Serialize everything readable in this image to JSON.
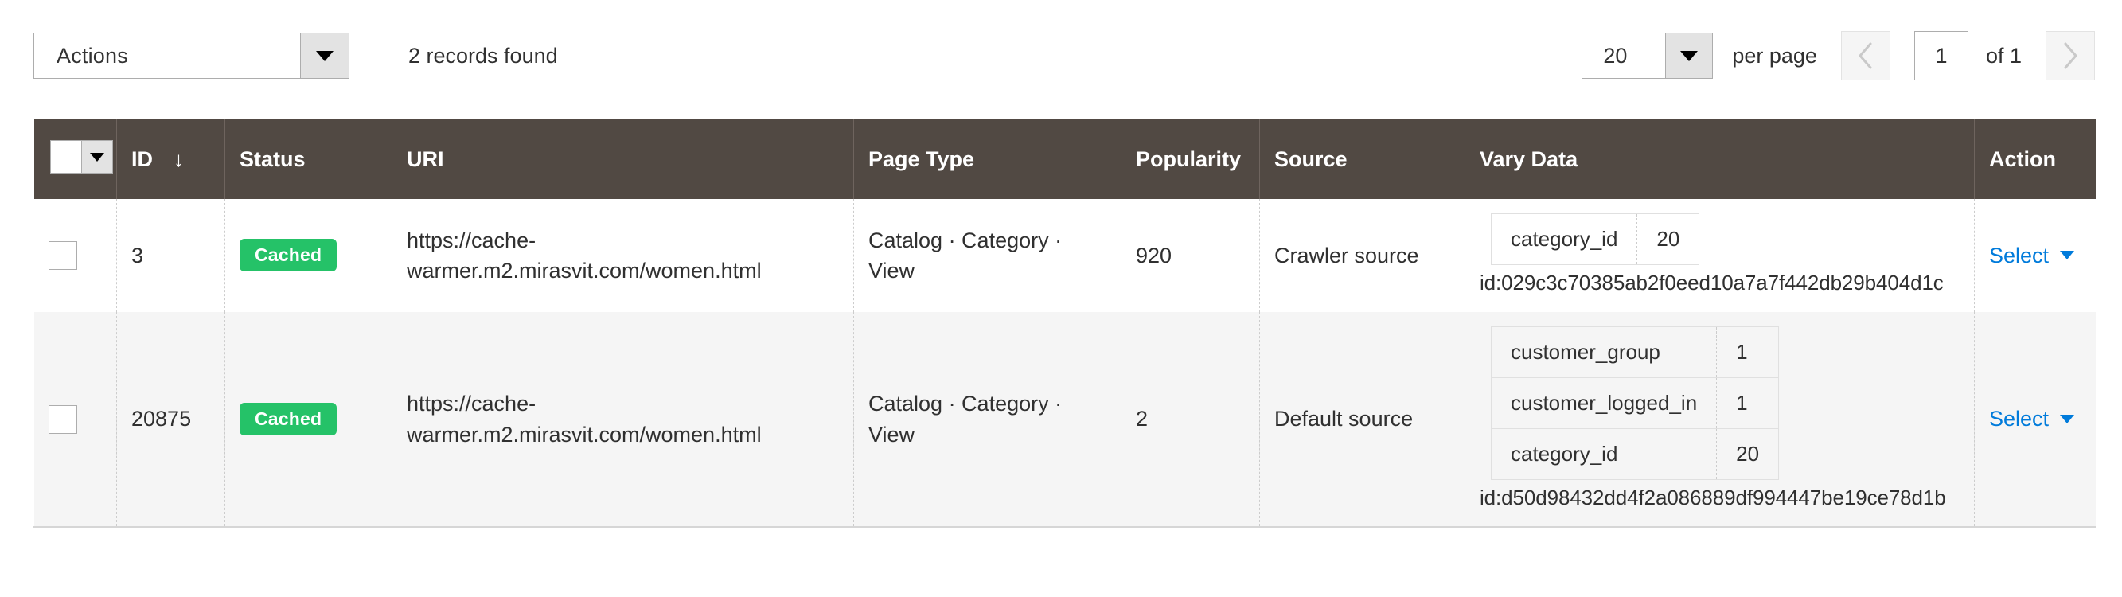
{
  "toolbar": {
    "actions_label": "Actions",
    "actions_caret": "chevron-down-icon",
    "records_found": "2 records found"
  },
  "pager": {
    "per_page_value": "20",
    "per_page_label": "per page",
    "prev_icon": "chevron-left-icon",
    "next_icon": "chevron-right-icon",
    "current_page": "1",
    "of_label": "of 1"
  },
  "table": {
    "columns": [
      {
        "key": "check",
        "label": ""
      },
      {
        "key": "id",
        "label": "ID",
        "sort": "↓"
      },
      {
        "key": "status",
        "label": "Status"
      },
      {
        "key": "uri",
        "label": "URI"
      },
      {
        "key": "page_type",
        "label": "Page Type"
      },
      {
        "key": "popularity",
        "label": "Popularity"
      },
      {
        "key": "source",
        "label": "Source"
      },
      {
        "key": "vary_data",
        "label": "Vary Data"
      },
      {
        "key": "action",
        "label": "Action"
      }
    ],
    "rows": [
      {
        "id": "3",
        "status": "Cached",
        "uri": "https://cache-warmer.m2.mirasvit.com/women.html",
        "page_type": "Catalog · Category · View",
        "popularity": "920",
        "source": "Crawler source",
        "vary": [
          {
            "key": "category_id",
            "value": "20"
          }
        ],
        "vary_id": "id:029c3c70385ab2f0eed10a7a7f442db29b404d1c",
        "action": "Select"
      },
      {
        "id": "20875",
        "status": "Cached",
        "uri": "https://cache-warmer.m2.mirasvit.com/women.html",
        "page_type": "Catalog · Category · View",
        "popularity": "2",
        "source": "Default source",
        "vary": [
          {
            "key": "customer_group",
            "value": "1"
          },
          {
            "key": "customer_logged_in",
            "value": "1"
          },
          {
            "key": "category_id",
            "value": "20"
          }
        ],
        "vary_id": "id:d50d98432dd4f2a086889df994447be19ce78d1b",
        "action": "Select"
      }
    ]
  },
  "colors": {
    "header_bg": "#514943",
    "badge_cached": "#25c268",
    "link": "#007bdb",
    "row_alt_bg": "#f5f5f5"
  }
}
